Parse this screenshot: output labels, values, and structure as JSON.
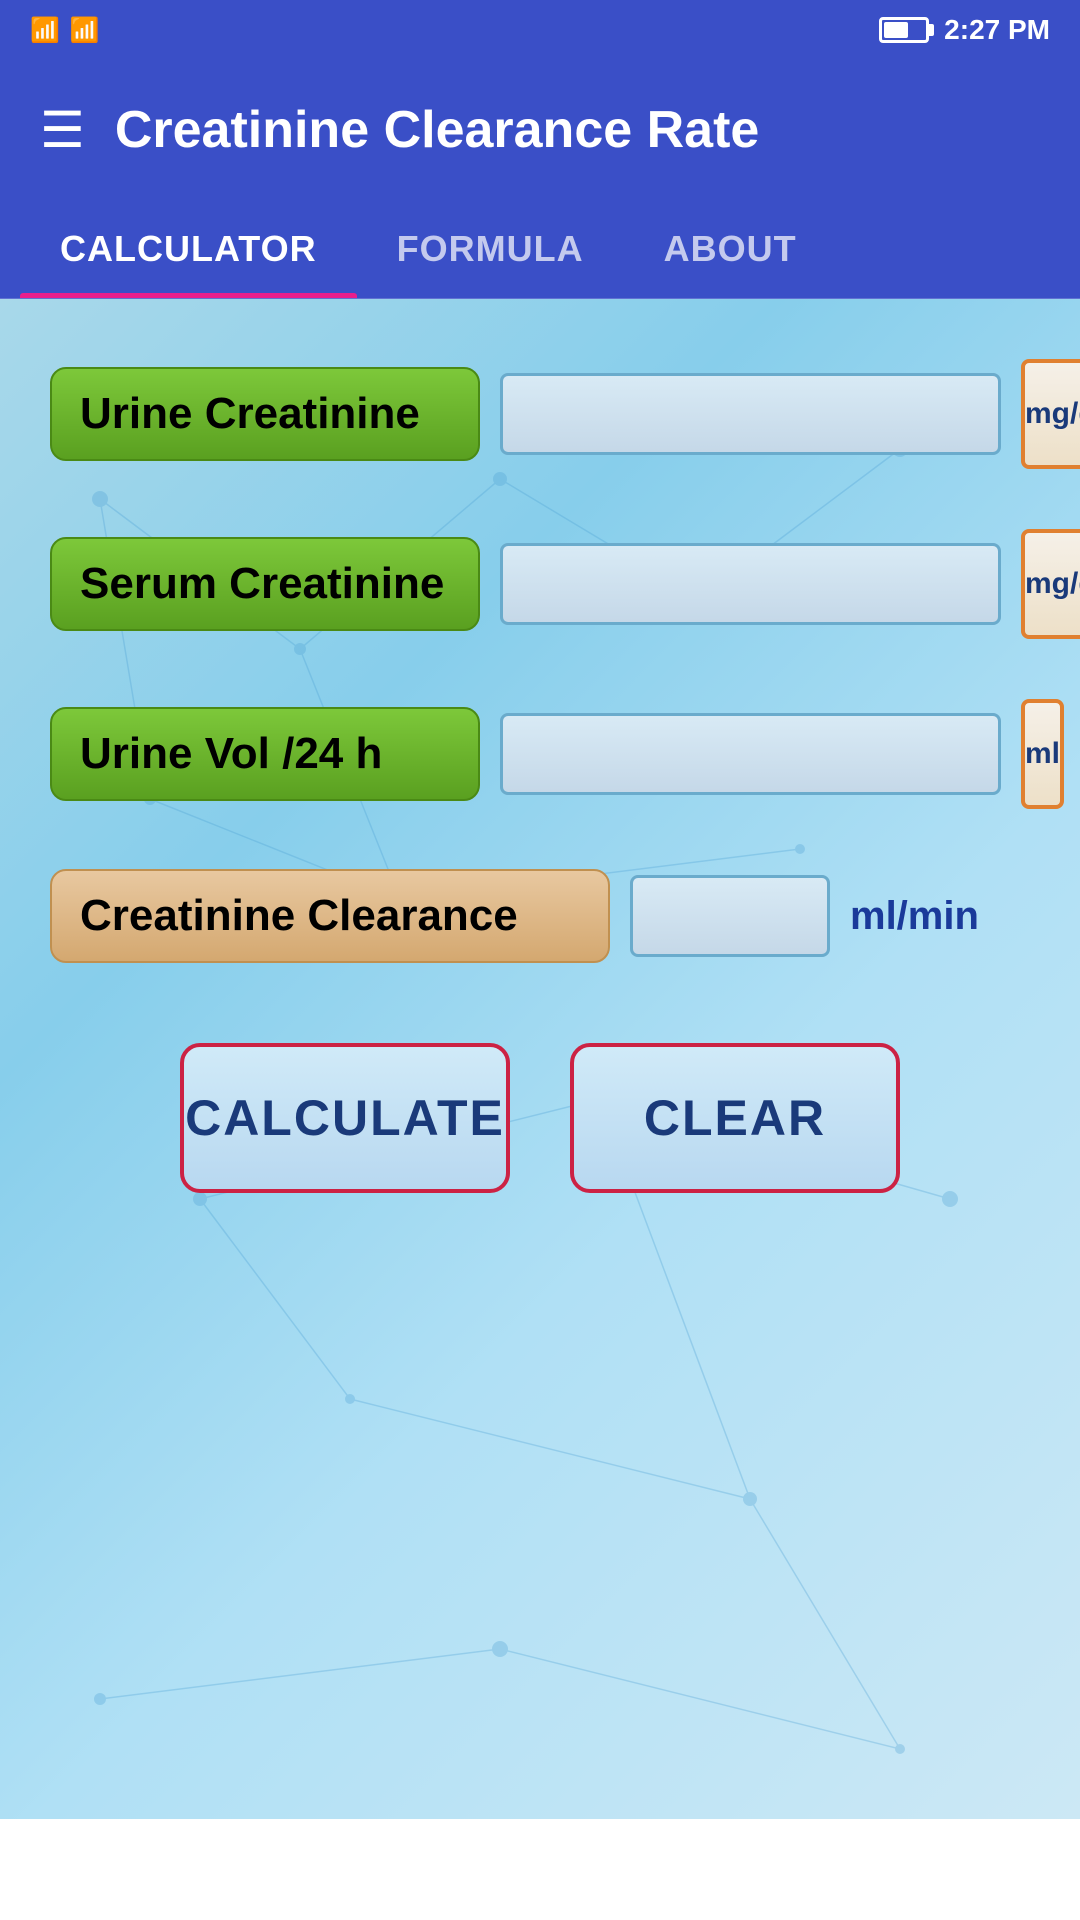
{
  "statusBar": {
    "time": "2:27 PM",
    "batteryPercent": 55
  },
  "header": {
    "title": "Creatinine Clearance Rate",
    "menuLabel": "☰"
  },
  "tabs": [
    {
      "id": "calculator",
      "label": "CALCULATOR",
      "active": true
    },
    {
      "id": "formula",
      "label": "FORMULA",
      "active": false
    },
    {
      "id": "about",
      "label": "ABOUT",
      "active": false
    }
  ],
  "fields": [
    {
      "id": "urine-creatinine",
      "label": "Urine Creatinine",
      "unit": "mg/dL",
      "placeholder": "",
      "hasFocus": true
    },
    {
      "id": "serum-creatinine",
      "label": "Serum Creatinine",
      "unit": "mg/dL",
      "placeholder": "",
      "hasFocus": false
    },
    {
      "id": "urine-vol",
      "label": "Urine Vol /24 h",
      "unit": "ml",
      "placeholder": "",
      "hasFocus": false
    }
  ],
  "result": {
    "label": "Creatinine Clearance",
    "unit": "ml/min",
    "value": ""
  },
  "buttons": {
    "calculate": "CALCULATE",
    "clear": "CLEAR"
  }
}
